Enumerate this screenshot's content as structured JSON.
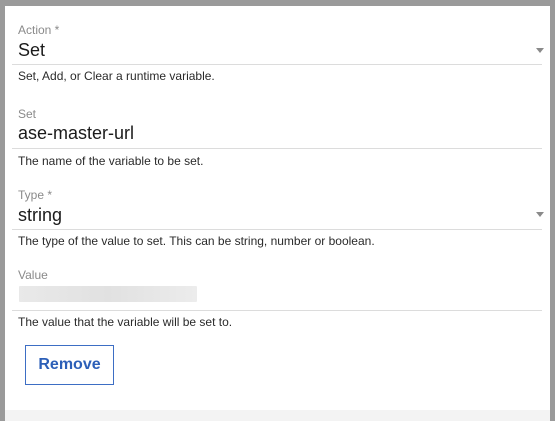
{
  "action_field": {
    "label": "Action *",
    "value": "Set",
    "help": "Set, Add, or Clear a runtime variable.",
    "caret_icon": "chevron-down-icon"
  },
  "set_field": {
    "label": "Set",
    "value": "ase-master-url",
    "help": "The name of the variable to be set."
  },
  "type_field": {
    "label": "Type *",
    "value": "string",
    "help": "The type of the value to set. This can be string, number or boolean.",
    "caret_icon": "chevron-down-icon"
  },
  "value_field": {
    "label": "Value",
    "help": "The value that the variable will be set to."
  },
  "remove_button": {
    "label": "Remove",
    "color": "#2c5fb8"
  }
}
